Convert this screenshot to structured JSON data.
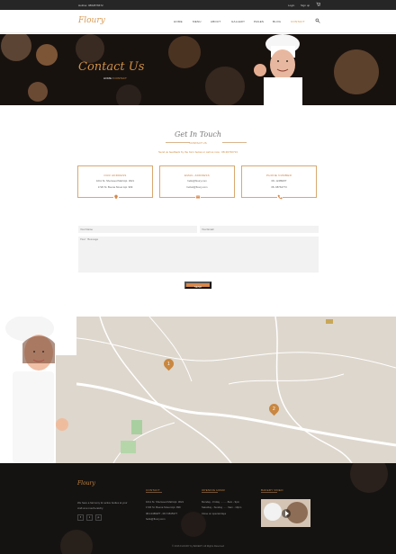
{
  "topbar": {
    "hotline": "Hotline: 0862876672",
    "login": "Login",
    "signup": "Sign up"
  },
  "nav": {
    "logo": "Floury",
    "items": [
      "HOME",
      "MENU",
      "ABOUT",
      "GALLERY",
      "PAGES",
      "BLOG",
      "CONTACT"
    ]
  },
  "hero": {
    "title": "Contact Us",
    "home": "HOME",
    "current": "CONTACT"
  },
  "contact": {
    "title": "Get In Touch",
    "subtitle": "CONTACT US",
    "intro": "Send us feedback by the form below or call us now :",
    "phone_link": "08-30740713",
    "cards": [
      {
        "title": "OUR ADDRESS",
        "line1": "1011 St. Sherwood Mall Apt. 3021",
        "line2": "1720 St. Buena Street Apt. 999"
      },
      {
        "title": "EMAIL ADDRESS",
        "line1": "hello@floury.com",
        "line2": "hello2@floury.com"
      },
      {
        "title": "PHONE NUMBER",
        "line1": "08- 12489WT",
        "line2": "08- 98764773"
      }
    ],
    "name_placeholder": "Your Name",
    "email_placeholder": "Your Email",
    "message_placeholder": "Your Message",
    "send": "SEND"
  },
  "map": {
    "marker1": "1",
    "marker2": "2"
  },
  "footer": {
    "logo": "Floury",
    "about": "We have a harmony for active bodies at your craft at a mouth-catchy.",
    "contact_title": "CONTACT",
    "contact_lines": [
      "1011 St. Sherwood Mall Apt. 3021",
      "1720 St. Buena Street Apt. 999",
      "08-12489WT - 08-74545377",
      "hello@floury.com"
    ],
    "hours_title": "OPENING HOUR",
    "hours_lines": [
      "Monday - Friday ..........8am - 9pm",
      "Saturday - Sunday ...... 9am - 10pm",
      "Close on special days"
    ],
    "video_title": "BAKERY VIDEO",
    "copyright": "© 2016 FLOURY by BAKERY. All Rights Reserved"
  },
  "colors": {
    "accent": "#d08b3f",
    "dark": "#151312",
    "map": "#ded7cd"
  }
}
